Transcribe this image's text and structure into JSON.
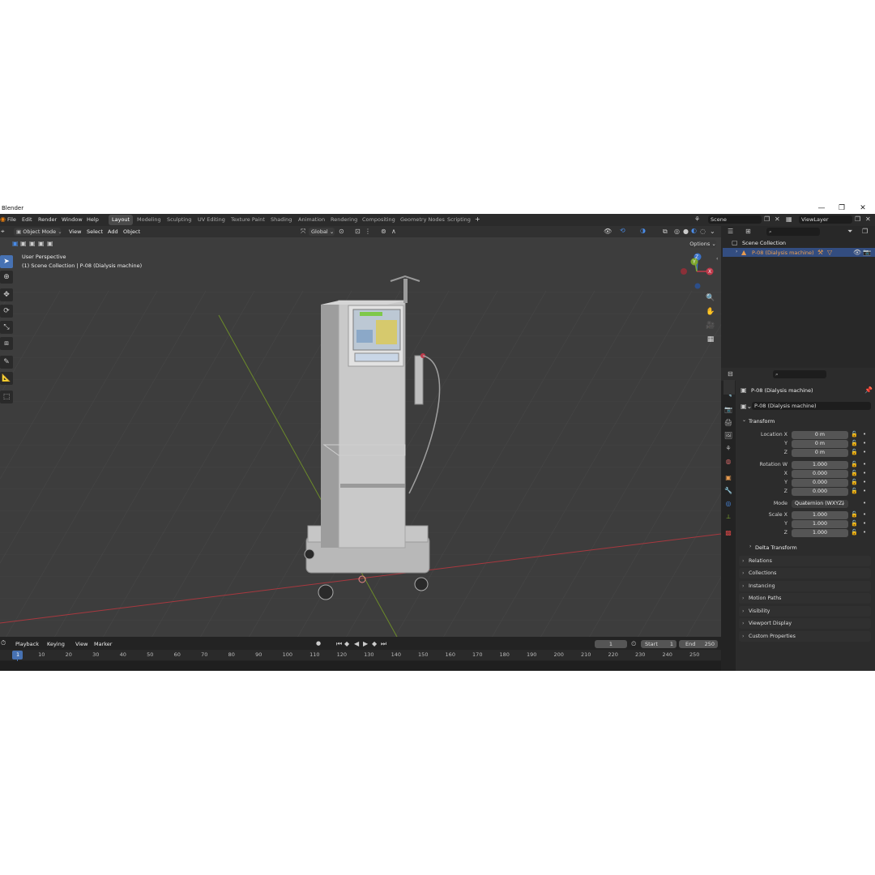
{
  "app": {
    "title": "Blender",
    "minimize": "—",
    "maximize": "❐",
    "close": "✕"
  },
  "menu": [
    "File",
    "Edit",
    "Render",
    "Window",
    "Help"
  ],
  "workspaces": [
    "Layout",
    "Modeling",
    "Sculpting",
    "UV Editing",
    "Texture Paint",
    "Shading",
    "Animation",
    "Rendering",
    "Compositing",
    "Geometry Nodes",
    "Scripting"
  ],
  "active_workspace": "Layout",
  "add_workspace": "+",
  "scene": {
    "name": "Scene"
  },
  "view_layer": {
    "name": "ViewLayer"
  },
  "viewport": {
    "mode": "Object Mode",
    "menus": [
      "View",
      "Select",
      "Add",
      "Object"
    ],
    "transform_orientation": "Global",
    "options_label": "Options",
    "perspective_label": "User Perspective",
    "collection_label": "(1) Scene Collection | P-08 (Dialysis machine)",
    "gizmo": {
      "z": "Z",
      "y": "Y",
      "x": "X"
    },
    "colors": {
      "x_axis": "#c0394a",
      "y_axis": "#7da62c",
      "z_axis": "#3a72c9",
      "background": "#3d3d3d"
    }
  },
  "outliner": {
    "root": "Scene Collection",
    "items": [
      {
        "label": "P-08 (Dialysis machine)",
        "selected": true
      }
    ]
  },
  "properties": {
    "object_name": "P-08 (Dialysis machine)",
    "data_name": "P-08 (Dialysis machine)",
    "transform": {
      "title": "Transform",
      "location_label": "Location X",
      "location": [
        "0 m",
        "0 m",
        "0 m"
      ],
      "rotation_label": "Rotation W",
      "rotation": [
        "1.000",
        "0.000",
        "0.000",
        "0.000"
      ],
      "mode_label": "Mode",
      "mode": "Quaternion (WXYZ)",
      "scale_label": "Scale X",
      "scale": [
        "1.000",
        "1.000",
        "1.000"
      ],
      "axis_y": "Y",
      "axis_z": "Z",
      "axis_x": "X",
      "delta": "Delta Transform"
    },
    "panels": [
      "Relations",
      "Collections",
      "Instancing",
      "Motion Paths",
      "Visibility",
      "Viewport Display",
      "Custom Properties"
    ]
  },
  "timeline": {
    "menus": [
      "Playback",
      "Keying",
      "View",
      "Marker"
    ],
    "current_frame": "1",
    "start_label": "Start",
    "start": "1",
    "end_label": "End",
    "end": "250",
    "ticks": [
      "1",
      "10",
      "20",
      "30",
      "40",
      "50",
      "60",
      "70",
      "80",
      "90",
      "100",
      "110",
      "120",
      "130",
      "140",
      "150",
      "160",
      "170",
      "180",
      "190",
      "200",
      "210",
      "220",
      "230",
      "240",
      "250"
    ]
  }
}
